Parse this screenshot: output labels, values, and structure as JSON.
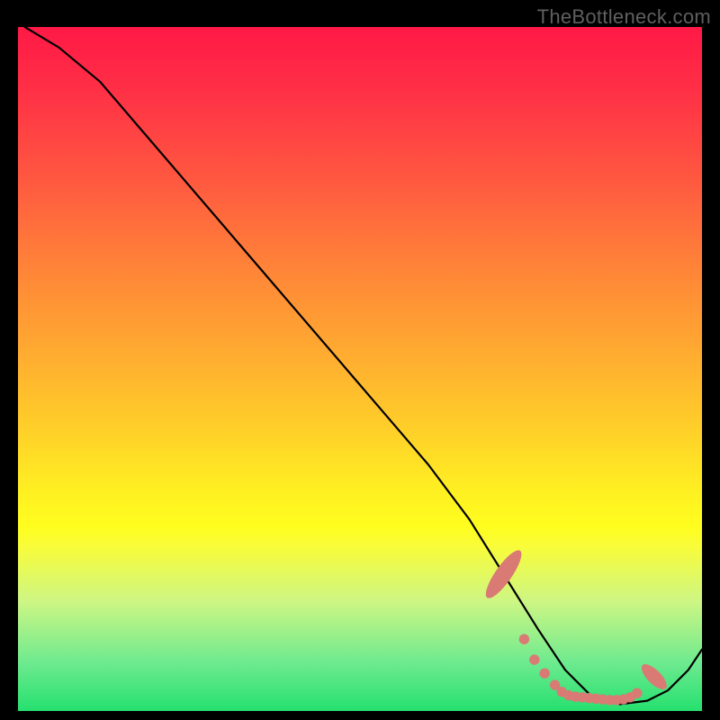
{
  "watermark": "TheBottleneck.com",
  "colors": {
    "marker": "#d97a74",
    "curve": "#000000",
    "background": "#000000"
  },
  "chart_data": {
    "type": "line",
    "title": "",
    "xlabel": "",
    "ylabel": "",
    "xlim": [
      0,
      100
    ],
    "ylim": [
      0,
      100
    ],
    "grid": false,
    "legend": false,
    "annotations": [
      "TheBottleneck.com"
    ],
    "series": [
      {
        "name": "curve",
        "x": [
          1,
          6,
          12,
          18,
          24,
          30,
          36,
          42,
          48,
          54,
          60,
          66,
          71,
          76,
          80,
          84,
          88,
          92,
          95,
          98,
          100
        ],
        "y": [
          100,
          97,
          92,
          85,
          78,
          71,
          64,
          57,
          50,
          43,
          36,
          28,
          20,
          12,
          6,
          2,
          1,
          1.5,
          3,
          6,
          9
        ]
      }
    ],
    "markers": {
      "comment": "Approximate positions of salmon dotted markers near the trough (x is % across, y is % up).",
      "oval_left": {
        "x": 71,
        "y": 20,
        "rx": 1.2,
        "ry": 4.2,
        "rot": 35
      },
      "oval_right": {
        "x": 93,
        "y": 5,
        "rx": 1.0,
        "ry": 2.4,
        "rot": -45
      },
      "dots": [
        {
          "x": 74.0,
          "y": 10.5
        },
        {
          "x": 75.5,
          "y": 7.5
        },
        {
          "x": 77.0,
          "y": 5.5
        },
        {
          "x": 78.5,
          "y": 3.8
        },
        {
          "x": 79.5,
          "y": 2.8
        },
        {
          "x": 80.5,
          "y": 2.3
        },
        {
          "x": 81.5,
          "y": 2.1
        },
        {
          "x": 82.5,
          "y": 2.0
        },
        {
          "x": 83.5,
          "y": 1.9
        },
        {
          "x": 84.5,
          "y": 1.8
        },
        {
          "x": 85.5,
          "y": 1.7
        },
        {
          "x": 86.5,
          "y": 1.6
        },
        {
          "x": 87.5,
          "y": 1.6
        },
        {
          "x": 88.5,
          "y": 1.7
        },
        {
          "x": 89.5,
          "y": 2.0
        },
        {
          "x": 90.5,
          "y": 2.6
        }
      ]
    }
  }
}
